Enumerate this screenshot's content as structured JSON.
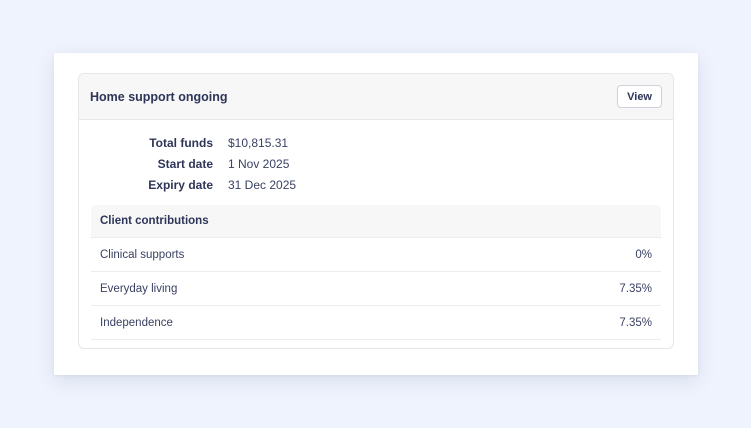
{
  "card": {
    "title": "Home support ongoing",
    "view_label": "View"
  },
  "details": [
    {
      "label": "Total funds",
      "value": "$10,815.31"
    },
    {
      "label": "Start date",
      "value": "1 Nov 2025"
    },
    {
      "label": "Expiry date",
      "value": "31 Dec 2025"
    }
  ],
  "contributions": {
    "header": "Client contributions",
    "rows": [
      {
        "name": "Clinical supports",
        "value": "0%"
      },
      {
        "name": "Everyday living",
        "value": "7.35%"
      },
      {
        "name": "Independence",
        "value": "7.35%"
      }
    ]
  },
  "colors": {
    "background": "#eef3fd",
    "text": "#2e3558",
    "header_bg": "#f7f7f8"
  }
}
